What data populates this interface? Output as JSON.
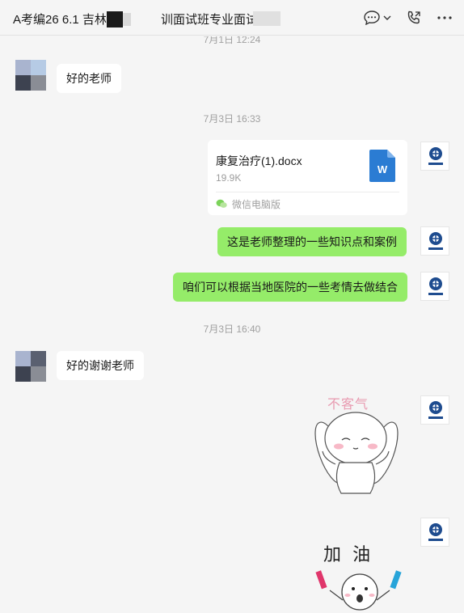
{
  "header": {
    "title_left": "A考编26 6.1 吉林",
    "title_right": "训面试班专业面试",
    "icons": [
      "chat-more-icon",
      "chevron-down-icon",
      "video-call-icon",
      "more-icon"
    ]
  },
  "timestamps": {
    "top_partial": "7月1日 12:24",
    "t1": "7月3日 16:33",
    "t2": "7月3日 16:40"
  },
  "messages": {
    "m1": "好的老师",
    "file": {
      "name": "康复治疗(1).docx",
      "size": "19.9K",
      "source": "微信电脑版",
      "icon_letter": "W"
    },
    "m2": "这是老师整理的一些知识点和案例",
    "m3": "咱们可以根据当地医院的一些考情去做结合",
    "m4": "好的谢谢老师",
    "sticker1_text": "不客气",
    "sticker2_text": "加 油"
  },
  "colors": {
    "out_bubble": "#95ec69",
    "in_bubble": "#ffffff",
    "word_blue": "#2b7cd3"
  }
}
